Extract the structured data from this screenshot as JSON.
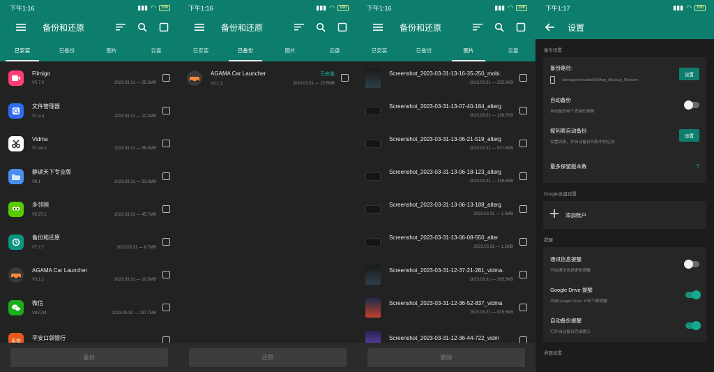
{
  "status": {
    "time1": "下午1:16",
    "time2": "下午1:16",
    "time3": "下午1:16",
    "time4": "下午1:17",
    "battery": "100"
  },
  "app_title": "备份和还原",
  "tabs": [
    "已安装",
    "已备份",
    "图片",
    "云盘"
  ],
  "screen1": {
    "apps": [
      {
        "name": "Filmigo",
        "version": "V5.7.0",
        "meta": "2023.03.31 — 55.3MB",
        "color": "#ff3d77",
        "icon": "video-icon"
      },
      {
        "name": "文件管理器",
        "version": "V1.4.4",
        "meta": "2023.03.31 — 12.2MB",
        "color": "#2f6cf2",
        "icon": "search-icon"
      },
      {
        "name": "Vidma",
        "version": "V1.44.0",
        "meta": "2023.03.31 — 56.5MB",
        "color": "#ffffff",
        "icon": "scissors-icon"
      },
      {
        "name": "静读天下专业版",
        "version": "V8.1",
        "meta": "2023.03.31 — 33.3MB",
        "color": "#4a8ff0",
        "icon": "folder-icon"
      },
      {
        "name": "多邻国",
        "version": "V5.97.2",
        "meta": "2023.03.31 — 45.7MB",
        "color": "#58cc02",
        "icon": "owl-icon"
      },
      {
        "name": "备份和还原",
        "version": "V7.2.7",
        "meta": "2023.03.31 — 6.7MB",
        "color": "#0d9480",
        "icon": "restore-icon"
      },
      {
        "name": "AGAMA Car Launcher",
        "version": "V3.1.1",
        "meta": "2023.03.31 — 10.5MB",
        "color": "#3a3a3a",
        "icon": "car-icon"
      },
      {
        "name": "微信",
        "version": "V8.0.34",
        "meta": "2023.03.30 — 237.7MB",
        "color": "#1aad19",
        "icon": "wechat-icon"
      },
      {
        "name": "平安口袋银行",
        "version": "",
        "meta": "",
        "color": "#e85a1c",
        "icon": "bank-icon"
      }
    ],
    "action": "备份"
  },
  "screen2": {
    "apps": [
      {
        "name": "AGAMA Car Launcher",
        "version": "V3.1.1",
        "meta": "2023.03.31 — 10.5MB",
        "status": "已安装"
      }
    ],
    "action": "还原"
  },
  "screen3": {
    "images": [
      {
        "name": "Screenshot_2023-03-31-13-16-35-250_mobi.",
        "meta": "2023.03.31 — 255.8KB",
        "shape": "tall"
      },
      {
        "name": "Screenshot_2023-03-31-13-07-40-184_alterg",
        "meta": "2023.03.31 — 138.7KB",
        "shape": "wide"
      },
      {
        "name": "Screenshot_2023-03-31-13-06-21-519_alterg",
        "meta": "2023.03.31 — 917.8KB",
        "shape": "wide"
      },
      {
        "name": "Screenshot_2023-03-31-13-06-18-123_alterg",
        "meta": "2023.03.31 — 148.5KB",
        "shape": "wide"
      },
      {
        "name": "Screenshot_2023-03-31-13-06-13-188_alterg",
        "meta": "2023.03.31 — 1.0MB",
        "shape": "wide"
      },
      {
        "name": "Screenshot_2023-03-31-13-06-08-550_alter",
        "meta": "2023.03.31 — 1.2MB",
        "shape": "wide"
      },
      {
        "name": "Screenshot_2023-03-31-12-37-21-281_vidma.",
        "meta": "2023.03.31 — 395.3KB",
        "shape": "tall"
      },
      {
        "name": "Screenshot_2023-03-31-12-36-52-837_vidma",
        "meta": "2023.03.31 — 876.5KB",
        "shape": "tall"
      },
      {
        "name": "Screenshot_2023-03-31-12-36-44-722_vidm",
        "meta": "",
        "shape": "tall"
      }
    ],
    "action": "删除"
  },
  "screen4": {
    "title": "设置",
    "sections": [
      {
        "title": "备份设置",
        "rows": [
          {
            "label": "备份路径:",
            "path": "/storage/emulated/0/App_Backup_Restore",
            "control": "button",
            "button": "设置"
          },
          {
            "label": "自动备份",
            "desc": "自动备份每个安装的更新",
            "control": "toggle",
            "on": false
          },
          {
            "label": "按列表自动备份",
            "desc": "设置列表，并自动备份列表中的应用",
            "control": "button",
            "button": "设置"
          },
          {
            "label": "最多保留版本数",
            "control": "value",
            "value": "5"
          }
        ]
      },
      {
        "title": "Google云盘设置",
        "rows": [
          {
            "label": "添加账户",
            "control": "add"
          }
        ]
      },
      {
        "title": "提醒",
        "rows": [
          {
            "label": "通讯信息提醒",
            "desc": "开启通讯信息更新提醒",
            "control": "toggle",
            "on": false
          },
          {
            "label": "Google Drive 提醒",
            "desc": "开启Google Drive 上传下载提醒",
            "control": "toggle",
            "on": true
          },
          {
            "label": "自动备份提醒",
            "desc": "打开自动备份完成提示",
            "control": "toggle",
            "on": true
          }
        ]
      },
      {
        "title": "界面设置",
        "rows": []
      }
    ]
  },
  "colors": {
    "accent": "#0d7e6e",
    "accent_text": "#1fb59a",
    "background": "#222222"
  }
}
